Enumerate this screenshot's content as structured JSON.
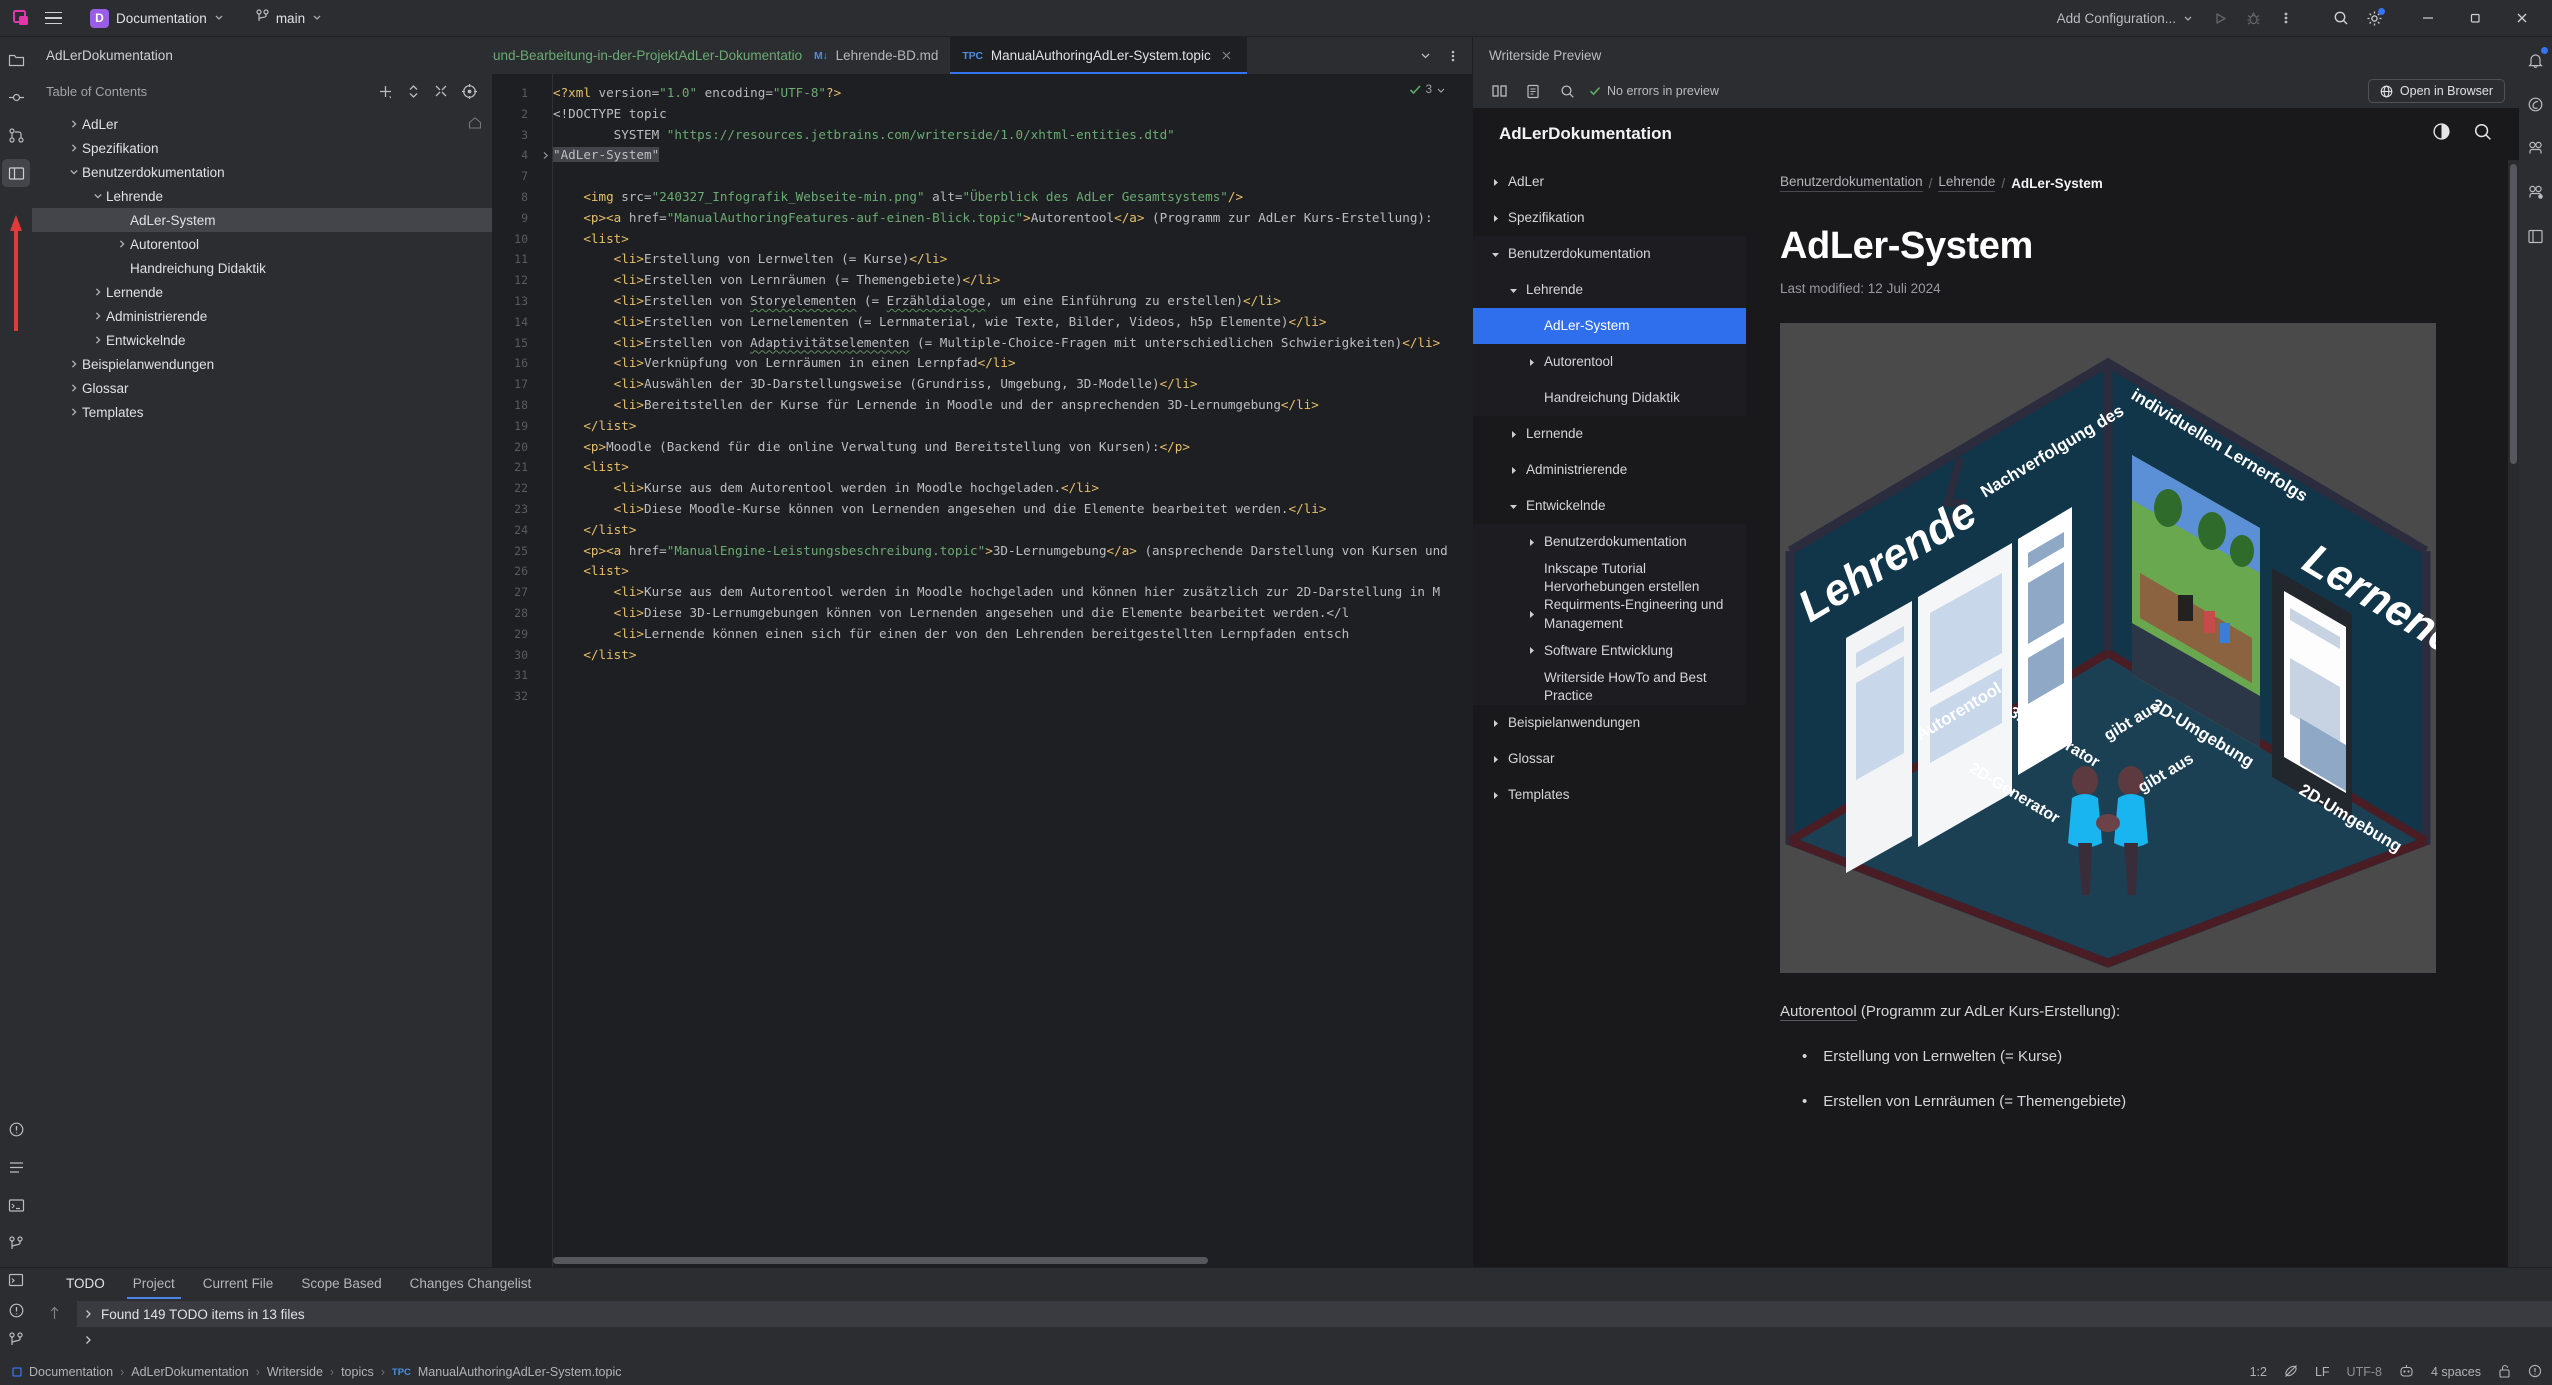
{
  "topbar": {
    "project_badge": "D",
    "project_name": "Documentation",
    "branch": "main",
    "run_config": "Add Configuration...",
    "icons": {
      "menu": "hamburger-icon",
      "branch": "vcs-branch-icon",
      "run": "run-icon",
      "debug": "debug-icon",
      "more": "more-vertical-icon",
      "search": "search-icon",
      "settings": "settings-gear-icon",
      "minimize": "minimize-icon",
      "maximize": "maximize-icon",
      "close": "close-icon"
    }
  },
  "toc": {
    "file_label": "AdLerDokumentation",
    "panel_title": "Table of Contents",
    "actions": [
      "add-icon",
      "expand-collapse-icon",
      "collapse-all-icon",
      "target-icon"
    ],
    "items": [
      {
        "label": "AdLer",
        "depth": 0,
        "arrow": "right",
        "selected": false
      },
      {
        "label": "Spezifikation",
        "depth": 0,
        "arrow": "right",
        "selected": false
      },
      {
        "label": "Benutzerdokumentation",
        "depth": 0,
        "arrow": "down",
        "selected": false
      },
      {
        "label": "Lehrende",
        "depth": 1,
        "arrow": "down",
        "selected": false
      },
      {
        "label": "AdLer-System",
        "depth": 2,
        "arrow": "none",
        "selected": true
      },
      {
        "label": "Autorentool",
        "depth": 2,
        "arrow": "right",
        "selected": false
      },
      {
        "label": "Handreichung Didaktik",
        "depth": 2,
        "arrow": "none",
        "selected": false
      },
      {
        "label": "Lernende",
        "depth": 1,
        "arrow": "right",
        "selected": false
      },
      {
        "label": "Administrierende",
        "depth": 1,
        "arrow": "right",
        "selected": false
      },
      {
        "label": "Entwickelnde",
        "depth": 1,
        "arrow": "right",
        "selected": false
      },
      {
        "label": "Beispielanwendungen",
        "depth": 0,
        "arrow": "right",
        "selected": false
      },
      {
        "label": "Glossar",
        "depth": 0,
        "arrow": "right",
        "selected": false
      },
      {
        "label": "Templates",
        "depth": 0,
        "arrow": "right",
        "selected": false
      }
    ]
  },
  "editor": {
    "tabs": [
      {
        "label": "-Erstellung-und-Bearbeitung-in-der-ProjektAdLer-Dokumentation.md",
        "type": "",
        "active": false,
        "truncated": true
      },
      {
        "label": "Lehrende-BD.md",
        "type": "M↓",
        "active": false
      },
      {
        "label": "ManualAuthoringAdLer-System.topic",
        "type": "TPC",
        "active": true,
        "closable": true
      }
    ],
    "inspection_count": "3",
    "line_numbers": [
      "1",
      "2",
      "3",
      "4",
      "7",
      "8",
      "9",
      "10",
      "11",
      "12",
      "13",
      "14",
      "15",
      "16",
      "17",
      "18",
      "19",
      "20",
      "21",
      "22",
      "23",
      "24",
      "25",
      "26",
      "27",
      "28",
      "29",
      "30",
      "31",
      "32"
    ],
    "lines": [
      {
        "n": "1",
        "indent": 0,
        "segments": [
          {
            "t": "<?xml ",
            "c": "tag"
          },
          {
            "t": "version=",
            "c": "attr"
          },
          {
            "t": "\"1.0\"",
            "c": "str"
          },
          {
            "t": " encoding=",
            "c": "attr"
          },
          {
            "t": "\"UTF-8\"",
            "c": "str"
          },
          {
            "t": "?>",
            "c": "tag"
          }
        ]
      },
      {
        "n": "2",
        "indent": 0,
        "segments": [
          {
            "t": "<!DOCTYPE topic",
            "c": "txt"
          }
        ]
      },
      {
        "n": "3",
        "indent": 0,
        "segments": [
          {
            "t": "        SYSTEM ",
            "c": "txt"
          },
          {
            "t": "\"https://resources.jetbrains.com/writerside/1.0/xhtml-entities.dtd\"",
            "c": "str"
          }
        ]
      },
      {
        "n": "4",
        "indent": 0,
        "fold": true,
        "segments": [
          {
            "t": "\"AdLer-System\"",
            "c": "sel"
          }
        ]
      },
      {
        "n": "7",
        "indent": 0,
        "segments": []
      },
      {
        "n": "8",
        "indent": 1,
        "segments": [
          {
            "t": "<img ",
            "c": "tag"
          },
          {
            "t": "src=",
            "c": "attr"
          },
          {
            "t": "\"240327_Infografik_Webseite-min.png\"",
            "c": "str"
          },
          {
            "t": " alt=",
            "c": "attr"
          },
          {
            "t": "\"Überblick des AdLer Gesamtsystems\"",
            "c": "str"
          },
          {
            "t": "/>",
            "c": "tag"
          }
        ]
      },
      {
        "n": "9",
        "indent": 1,
        "segments": [
          {
            "t": "<p><a ",
            "c": "tag"
          },
          {
            "t": "href=",
            "c": "attr"
          },
          {
            "t": "\"ManualAuthoringFeatures-auf-einen-Blick.topic\"",
            "c": "str"
          },
          {
            "t": ">",
            "c": "tag"
          },
          {
            "t": "Autorentool",
            "c": "txt"
          },
          {
            "t": "</a>",
            "c": "tag"
          },
          {
            "t": " (Programm zur AdLer Kurs-Erstellung):",
            "c": "txt"
          }
        ]
      },
      {
        "n": "10",
        "indent": 1,
        "segments": [
          {
            "t": "<list>",
            "c": "tag"
          }
        ]
      },
      {
        "n": "11",
        "indent": 2,
        "segments": [
          {
            "t": "<li>",
            "c": "tag"
          },
          {
            "t": "Erstellung von Lernwelten (= Kurse)",
            "c": "txt"
          },
          {
            "t": "</li>",
            "c": "tag"
          }
        ]
      },
      {
        "n": "12",
        "indent": 2,
        "segments": [
          {
            "t": "<li>",
            "c": "tag"
          },
          {
            "t": "Erstellen von Lernräumen (= Themengebiete)",
            "c": "txt"
          },
          {
            "t": "</li>",
            "c": "tag"
          }
        ]
      },
      {
        "n": "13",
        "indent": 2,
        "segments": [
          {
            "t": "<li>",
            "c": "tag"
          },
          {
            "t": "Erstellen von ",
            "c": "txt"
          },
          {
            "t": "Storyelementen",
            "c": "squig"
          },
          {
            "t": " (= ",
            "c": "txt"
          },
          {
            "t": "Erzähldialoge",
            "c": "squig"
          },
          {
            "t": ", um eine Einführung zu erstellen)",
            "c": "txt"
          },
          {
            "t": "</li>",
            "c": "tag"
          }
        ]
      },
      {
        "n": "14",
        "indent": 2,
        "segments": [
          {
            "t": "<li>",
            "c": "tag"
          },
          {
            "t": "Erstellen von Lernelementen (= Lernmaterial, wie Texte, Bilder, Videos, h5p Elemente)",
            "c": "txt"
          },
          {
            "t": "</li>",
            "c": "tag"
          }
        ]
      },
      {
        "n": "15",
        "indent": 2,
        "segments": [
          {
            "t": "<li>",
            "c": "tag"
          },
          {
            "t": "Erstellen von ",
            "c": "txt"
          },
          {
            "t": "Adaptivitätselementen",
            "c": "squig"
          },
          {
            "t": " (= Multiple-Choice-Fragen mit unterschiedlichen Schwierigkeiten)",
            "c": "txt"
          },
          {
            "t": "</li>",
            "c": "tag"
          }
        ]
      },
      {
        "n": "16",
        "indent": 2,
        "segments": [
          {
            "t": "<li>",
            "c": "tag"
          },
          {
            "t": "Verknüpfung von Lernräumen in einen Lernpfad",
            "c": "txt"
          },
          {
            "t": "</li>",
            "c": "tag"
          }
        ]
      },
      {
        "n": "17",
        "indent": 2,
        "segments": [
          {
            "t": "<li>",
            "c": "tag"
          },
          {
            "t": "Auswählen der 3D-Darstellungsweise (Grundriss, Umgebung, 3D-Modelle)",
            "c": "txt"
          },
          {
            "t": "</li>",
            "c": "tag"
          }
        ]
      },
      {
        "n": "18",
        "indent": 2,
        "segments": [
          {
            "t": "<li>",
            "c": "tag"
          },
          {
            "t": "Bereitstellen der Kurse für Lernende in Moodle und der ansprechenden 3D-Lernumgebung",
            "c": "txt"
          },
          {
            "t": "</li>",
            "c": "tag"
          }
        ]
      },
      {
        "n": "19",
        "indent": 1,
        "segments": [
          {
            "t": "</list>",
            "c": "tag"
          }
        ]
      },
      {
        "n": "20",
        "indent": 1,
        "segments": [
          {
            "t": "<p>",
            "c": "tag"
          },
          {
            "t": "Moodle (Backend für die online Verwaltung und Bereitstellung von Kursen):",
            "c": "txt"
          },
          {
            "t": "</p>",
            "c": "tag"
          }
        ]
      },
      {
        "n": "21",
        "indent": 1,
        "segments": [
          {
            "t": "<list>",
            "c": "tag"
          }
        ]
      },
      {
        "n": "22",
        "indent": 2,
        "segments": [
          {
            "t": "<li>",
            "c": "tag"
          },
          {
            "t": "Kurse aus dem Autorentool werden in Moodle hochgeladen.",
            "c": "txt"
          },
          {
            "t": "</li>",
            "c": "tag"
          }
        ]
      },
      {
        "n": "23",
        "indent": 2,
        "segments": [
          {
            "t": "<li>",
            "c": "tag"
          },
          {
            "t": "Diese Moodle-Kurse können von Lernenden angesehen und die Elemente bearbeitet werden.",
            "c": "txt"
          },
          {
            "t": "</li>",
            "c": "tag"
          }
        ]
      },
      {
        "n": "24",
        "indent": 1,
        "segments": [
          {
            "t": "</list>",
            "c": "tag"
          }
        ]
      },
      {
        "n": "25",
        "indent": 1,
        "segments": [
          {
            "t": "<p><a ",
            "c": "tag"
          },
          {
            "t": "href=",
            "c": "attr"
          },
          {
            "t": "\"ManualEngine-Leistungsbeschreibung.topic\"",
            "c": "str"
          },
          {
            "t": ">",
            "c": "tag"
          },
          {
            "t": "3D-Lernumgebung",
            "c": "txt"
          },
          {
            "t": "</a>",
            "c": "tag"
          },
          {
            "t": " (ansprechende Darstellung von Kursen und",
            "c": "txt"
          }
        ]
      },
      {
        "n": "26",
        "indent": 1,
        "segments": [
          {
            "t": "<list>",
            "c": "tag"
          }
        ]
      },
      {
        "n": "27",
        "indent": 2,
        "segments": [
          {
            "t": "<li>",
            "c": "tag"
          },
          {
            "t": "Kurse aus dem Autorentool werden in Moodle hochgeladen und können hier zusätzlich zur 2D-Darstellung in M",
            "c": "txt"
          }
        ]
      },
      {
        "n": "28",
        "indent": 2,
        "segments": [
          {
            "t": "<li>",
            "c": "tag"
          },
          {
            "t": "Diese 3D-Lernumgebungen können von Lernenden angesehen und die Elemente bearbeitet werden.</l",
            "c": "txt"
          }
        ]
      },
      {
        "n": "29",
        "indent": 2,
        "segments": [
          {
            "t": "<li>",
            "c": "tag"
          },
          {
            "t": "Lernende können einen sich für einen der von den Lehrenden bereitgestellten Lernpfaden entsch",
            "c": "txt"
          }
        ]
      },
      {
        "n": "30",
        "indent": 1,
        "segments": [
          {
            "t": "</list>",
            "c": "tag"
          }
        ]
      },
      {
        "n": "31",
        "indent": 0,
        "segments": []
      },
      {
        "n": "32",
        "indent": 0,
        "segments": []
      }
    ]
  },
  "preview": {
    "panel_title": "Writerside Preview",
    "toolbar": {
      "layout_icon": "split-layout-icon",
      "toc_icon": "document-structure-icon",
      "search_icon": "search-icon",
      "status": "No errors in preview",
      "open_browser": "Open in Browser",
      "globe_icon": "globe-icon"
    },
    "site": {
      "brand": "AdLerDokumentation",
      "theme_icon": "contrast-toggle-icon",
      "search_icon": "search-icon"
    },
    "nav": [
      {
        "label": "AdLer",
        "depth": 0,
        "arrow": "right",
        "selected": false,
        "shade": false
      },
      {
        "label": "Spezifikation",
        "depth": 0,
        "arrow": "right",
        "selected": false,
        "shade": false
      },
      {
        "label": "Benutzerdokumentation",
        "depth": 0,
        "arrow": "down",
        "selected": false,
        "shade": true
      },
      {
        "label": "Lehrende",
        "depth": 1,
        "arrow": "down",
        "selected": false,
        "shade": true
      },
      {
        "label": "AdLer-System",
        "depth": 2,
        "arrow": "none",
        "selected": true,
        "shade": false
      },
      {
        "label": "Autorentool",
        "depth": 2,
        "arrow": "right",
        "selected": false,
        "shade": true
      },
      {
        "label": "Handreichung Didaktik",
        "depth": 2,
        "arrow": "none",
        "selected": false,
        "shade": true
      },
      {
        "label": "Lernende",
        "depth": 1,
        "arrow": "right",
        "selected": false,
        "shade": false
      },
      {
        "label": "Administrierende",
        "depth": 1,
        "arrow": "right",
        "selected": false,
        "shade": false
      },
      {
        "label": "Entwickelnde",
        "depth": 1,
        "arrow": "down",
        "selected": false,
        "shade": false
      },
      {
        "label": "Benutzerdokumentation",
        "depth": 2,
        "arrow": "right",
        "selected": false,
        "shade": true
      },
      {
        "label": "Inkscape Tutorial Hervorhebungen erstellen",
        "depth": 2,
        "arrow": "none",
        "selected": false,
        "shade": true
      },
      {
        "label": "Requirments-Engineering und Management",
        "depth": 2,
        "arrow": "right",
        "selected": false,
        "shade": true
      },
      {
        "label": "Software Entwicklung",
        "depth": 2,
        "arrow": "right",
        "selected": false,
        "shade": true
      },
      {
        "label": "Writerside HowTo and Best Practice",
        "depth": 2,
        "arrow": "none",
        "selected": false,
        "shade": true
      },
      {
        "label": "Beispielanwendungen",
        "depth": 0,
        "arrow": "right",
        "selected": false,
        "shade": false
      },
      {
        "label": "Glossar",
        "depth": 0,
        "arrow": "right",
        "selected": false,
        "shade": false
      },
      {
        "label": "Templates",
        "depth": 0,
        "arrow": "right",
        "selected": false,
        "shade": false
      }
    ],
    "breadcrumbs": [
      {
        "label": "Benutzerdokumentation",
        "current": false
      },
      {
        "label": "Lehrende",
        "current": false
      },
      {
        "label": "AdLer-System",
        "current": true
      }
    ],
    "heading": "AdLer-System",
    "last_modified": "Last modified: 12 Juli 2024",
    "infographic": {
      "alt": "Überblick des AdLer Gesamtsystems",
      "labels": {
        "left_wall": "Lehrende",
        "right_wall": "Lernende",
        "top_edge": "Nachverfolgung des individuellen Lernerfolgs",
        "autorentool": "Autorentool",
        "umgebung_3d": "3D-Umgebung",
        "umgebung_2d": "2D-Umgebung",
        "gen3d": "3D-Generator",
        "gen3d_out": "gibt aus",
        "gen2d": "2D-Generator",
        "gen2d_out": "gibt aus"
      },
      "colors": {
        "floor": "#1b4054",
        "wall": "#123649",
        "edge": "#4a1c24",
        "bg": "#4a4a4a",
        "person": "#19b5f0"
      }
    },
    "paragraph": {
      "link": "Autorentool",
      "rest": " (Programm zur AdLer Kurs-Erstellung):"
    },
    "bullets": [
      "Erstellung von Lernwelten (= Kurse)",
      "Erstellen von Lernräumen (= Themengebiete)"
    ]
  },
  "todo_panel": {
    "tabs": [
      {
        "label": "TODO",
        "active": false,
        "bold": true
      },
      {
        "label": "Project",
        "active": true,
        "bold": false
      },
      {
        "label": "Current File",
        "active": false,
        "bold": false
      },
      {
        "label": "Scope Based",
        "active": false,
        "bold": false
      },
      {
        "label": "Changes Changelist",
        "active": false,
        "bold": false
      }
    ],
    "summary": "Found 149 TODO items in 13 files"
  },
  "statusbar": {
    "crumbs": [
      {
        "label": "Documentation",
        "icon": "project-icon"
      },
      {
        "label": "AdLerDokumentation",
        "icon": ""
      },
      {
        "label": "Writerside",
        "icon": ""
      },
      {
        "label": "topics",
        "icon": ""
      },
      {
        "label": "ManualAuthoringAdLer-System.topic",
        "icon": "TPC"
      }
    ],
    "right": {
      "position": "1:2",
      "inspections_icon": "inspections-off-icon",
      "line_sep": "LF",
      "encoding": "UTF-8",
      "plugin_icon": "ai-assistant-icon",
      "indent": "4 spaces",
      "lock_icon": "unlocked-icon",
      "notify_icon": "notifications-icon"
    }
  },
  "rails": {
    "left": [
      "project-icon",
      "commit-icon",
      "pull-requests-icon",
      "preview-icon",
      "problems-icon",
      "terminal-icon",
      "git-icon"
    ],
    "right": [
      "notifications-icon",
      "ai-assistant-icon",
      "database-icon",
      "gradle-icon",
      "bookmarks-icon"
    ]
  }
}
